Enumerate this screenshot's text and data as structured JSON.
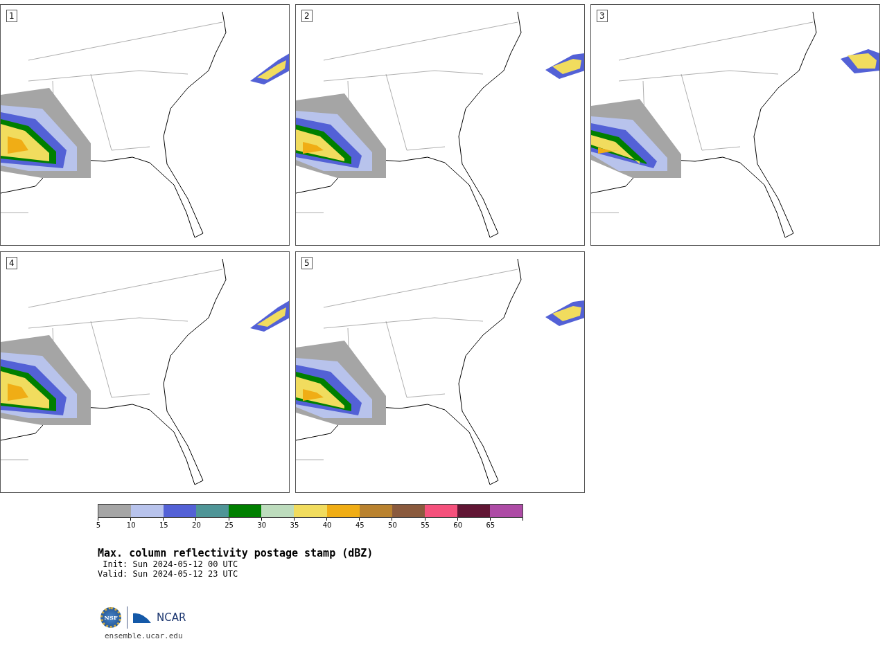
{
  "panels": [
    {
      "label": "1"
    },
    {
      "label": "2"
    },
    {
      "label": "3"
    },
    {
      "label": "4"
    },
    {
      "label": "5"
    }
  ],
  "colorbar": {
    "bins": [
      {
        "color": "#a5a5a5"
      },
      {
        "color": "#b8c3ec"
      },
      {
        "color": "#5361d6"
      },
      {
        "color": "#4f9597"
      },
      {
        "color": "#007f00"
      },
      {
        "color": "#bddcbd"
      },
      {
        "color": "#f1dc5e"
      },
      {
        "color": "#f0ad15"
      },
      {
        "color": "#b9822f"
      },
      {
        "color": "#8a5a3d"
      },
      {
        "color": "#f5517c"
      },
      {
        "color": "#611634"
      },
      {
        "color": "#ad4ba5"
      }
    ],
    "ticks": [
      "5",
      "10",
      "15",
      "20",
      "25",
      "30",
      "35",
      "40",
      "45",
      "50",
      "55",
      "60",
      "65"
    ]
  },
  "title": "Max. column reflectivity postage stamp (dBZ)",
  "init": " Init: Sun 2024-05-12 00 UTC",
  "valid": "Valid: Sun 2024-05-12 23 UTC",
  "logo": {
    "left": "NSF",
    "right": "NCAR"
  },
  "footer": "ensemble.ucar.edu"
}
